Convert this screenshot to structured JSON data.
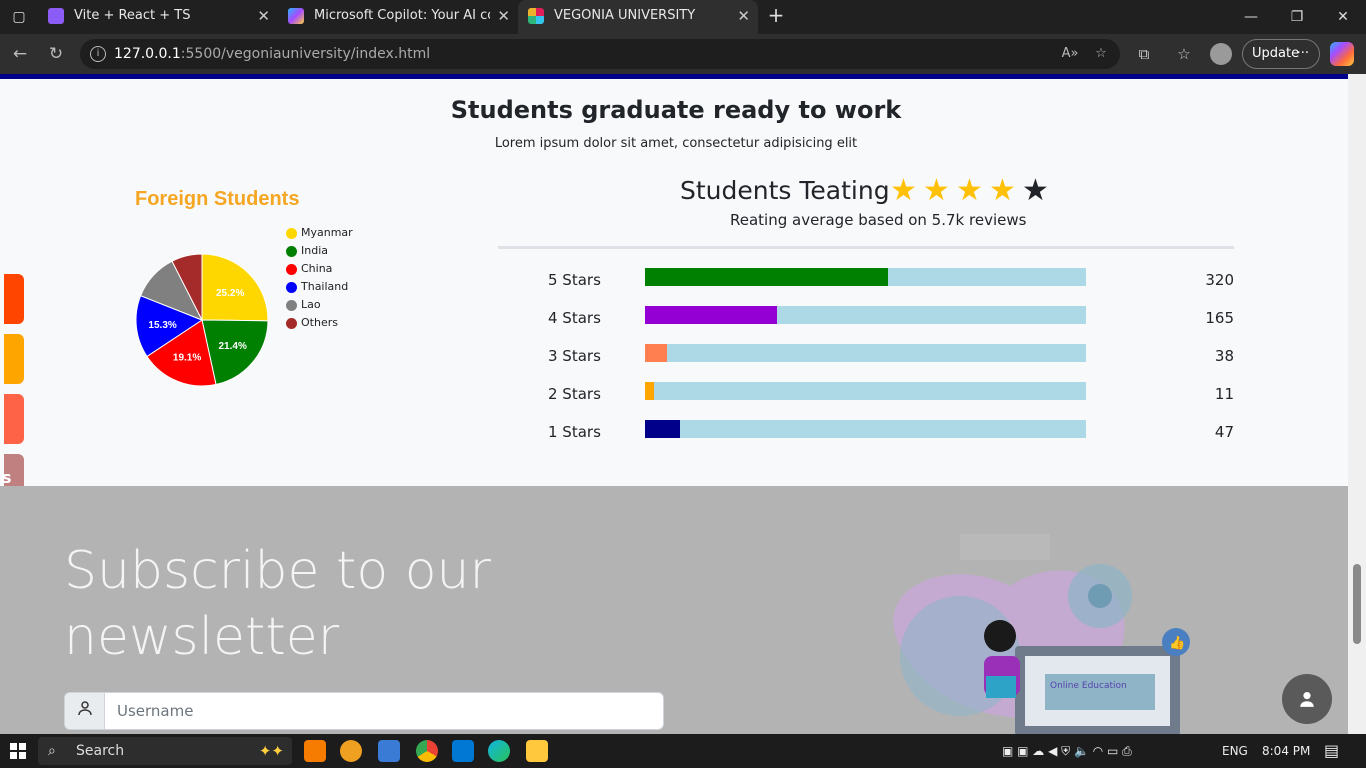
{
  "browser": {
    "tabs": [
      {
        "title": "Vite + React + TS",
        "color": "#8b5cf6"
      },
      {
        "title": "Microsoft Copilot: Your AI compan",
        "color": "#3b82f6"
      },
      {
        "title": "VEGONIA UNIVERSITY",
        "color": "#e11d48"
      }
    ],
    "url_host": "127.0.0.1",
    "url_path": ":5500/vegoniauniversity/index.html",
    "update_label": "Update",
    "more_label": "···"
  },
  "section": {
    "heading": "Students graduate ready to work",
    "subheading": "Lorem ipsum dolor sit amet, consectetur adipisicing elit"
  },
  "foreign": {
    "title": "Foreign Students",
    "legend": [
      {
        "label": "Myanmar",
        "color": "#ffd700"
      },
      {
        "label": "India",
        "color": "#008000"
      },
      {
        "label": "China",
        "color": "#ff0000"
      },
      {
        "label": "Thailand",
        "color": "#0000ff"
      },
      {
        "label": "Lao",
        "color": "#808080"
      },
      {
        "label": "Others",
        "color": "#a52a2a"
      }
    ]
  },
  "chart_data": {
    "type": "pie",
    "title": "Foreign Students",
    "categories": [
      "Myanmar",
      "India",
      "China",
      "Thailand",
      "Lao",
      "Others"
    ],
    "values": [
      25.2,
      21.4,
      19.1,
      15.3,
      11.5,
      7.5
    ],
    "labels": [
      "25.2%",
      "21.4%",
      "19.1%",
      "15.3%",
      "",
      ""
    ],
    "colors": [
      "#ffd700",
      "#008000",
      "#ff0000",
      "#0000ff",
      "#808080",
      "#a52a2a"
    ]
  },
  "rating": {
    "title": "Students Teating",
    "subtitle": "Reating average based on 5.7k reviews",
    "stars_filled": 4,
    "stars_total": 5,
    "rows": [
      {
        "label": "5 Stars",
        "count": "320",
        "fraction": 0.55,
        "color": "#008000"
      },
      {
        "label": "4 Stars",
        "count": "165",
        "fraction": 0.3,
        "color": "#9400d3"
      },
      {
        "label": "3 Stars",
        "count": "38",
        "fraction": 0.05,
        "color": "#ff7f50"
      },
      {
        "label": "2 Stars",
        "count": "11",
        "fraction": 0.02,
        "color": "#ffa500"
      },
      {
        "label": "1 Stars",
        "count": "47",
        "fraction": 0.08,
        "color": "#00008b"
      }
    ]
  },
  "newsletter": {
    "title": "Subscribe to our newsletter",
    "username_placeholder": "Username",
    "illustration_text": "Online Education"
  },
  "side_tabs": [
    {
      "color": "#ff4500",
      "label": ""
    },
    {
      "color": "#ffa500",
      "label": ""
    },
    {
      "color": "#ff6347",
      "label": ""
    },
    {
      "color": "#c08080",
      "label": "s"
    }
  ],
  "taskbar": {
    "search_label": "Search",
    "lang": "ENG",
    "time": "8:04 PM"
  }
}
